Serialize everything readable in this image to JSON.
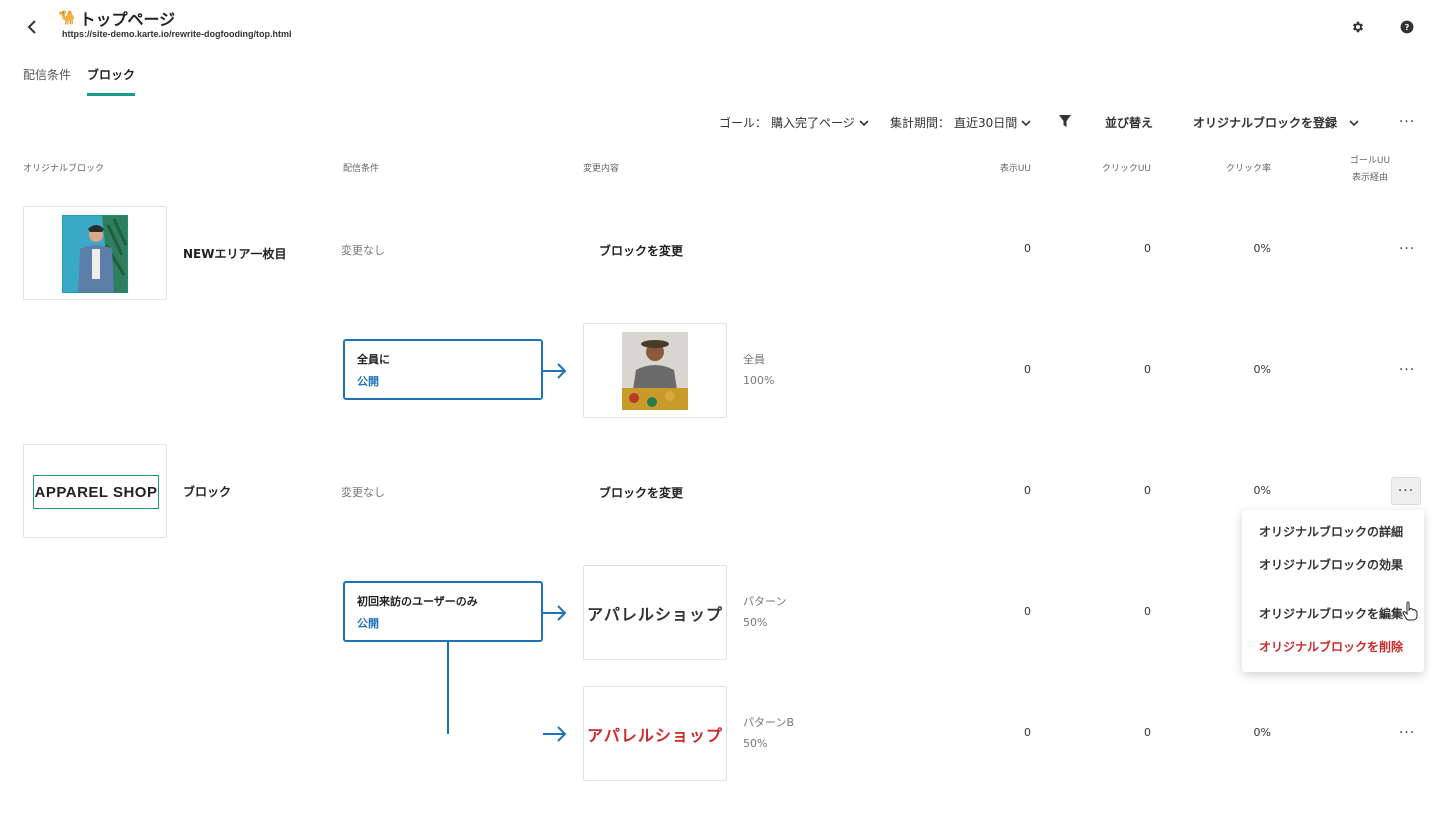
{
  "header": {
    "title": "トップページ",
    "title_emoji": "🐪",
    "url": "https://site-demo.karte.io/rewrite-dogfooding/top.html"
  },
  "tabs": [
    {
      "label": "配信条件",
      "active": false
    },
    {
      "label": "ブロック",
      "active": true
    }
  ],
  "toolbar": {
    "goal_label": "ゴール：",
    "goal_value": "購入完了ページ",
    "period_label": "集計期間：",
    "period_value": "直近30日間",
    "sort_label": "並び替え",
    "register_label": "オリジナルブロックを登録"
  },
  "columns": {
    "original_block": "オリジナルブロック",
    "condition": "配信条件",
    "change": "変更内容",
    "view_uu": "表示UU",
    "click_uu": "クリックUU",
    "click_rate": "クリック率",
    "goal_uu_line1": "ゴールUU",
    "goal_uu_line2": "表示経由"
  },
  "blocks": [
    {
      "name": "NEWエリア一枚目",
      "condition": "変更なし",
      "change": "ブロックを変更",
      "view_uu": "0",
      "click_uu": "0",
      "click_rate": "0%",
      "variant": {
        "cond_title": "全員に",
        "cond_status": "公開",
        "label": "全員",
        "percent": "100%",
        "view_uu": "0",
        "click_uu": "0",
        "click_rate": "0%"
      }
    },
    {
      "name": "ブロック",
      "logo_text": "APPAREL SHOP",
      "condition": "変更なし",
      "change": "ブロックを変更",
      "view_uu": "0",
      "click_uu": "0",
      "click_rate": "0%",
      "variant_cond_title": "初回来訪のユーザーのみ",
      "variant_cond_status": "公開",
      "variants": [
        {
          "shop_text": "アパレルショップ",
          "label": "パターン",
          "percent": "50%",
          "view_uu": "0",
          "click_uu": "0"
        },
        {
          "shop_text": "アパレルショップ",
          "label": "パターンB",
          "percent": "50%",
          "view_uu": "0",
          "click_uu": "0",
          "click_rate": "0%"
        }
      ]
    }
  ],
  "menu": {
    "items": [
      {
        "label": "オリジナルブロックの詳細"
      },
      {
        "label": "オリジナルブロックの効果"
      },
      {
        "label": "オリジナルブロックを編集"
      },
      {
        "label": "オリジナルブロックを削除"
      }
    ]
  },
  "colors": {
    "accent": "#1a9a8a",
    "link": "#1e73b8",
    "danger": "#cc2a2a"
  }
}
